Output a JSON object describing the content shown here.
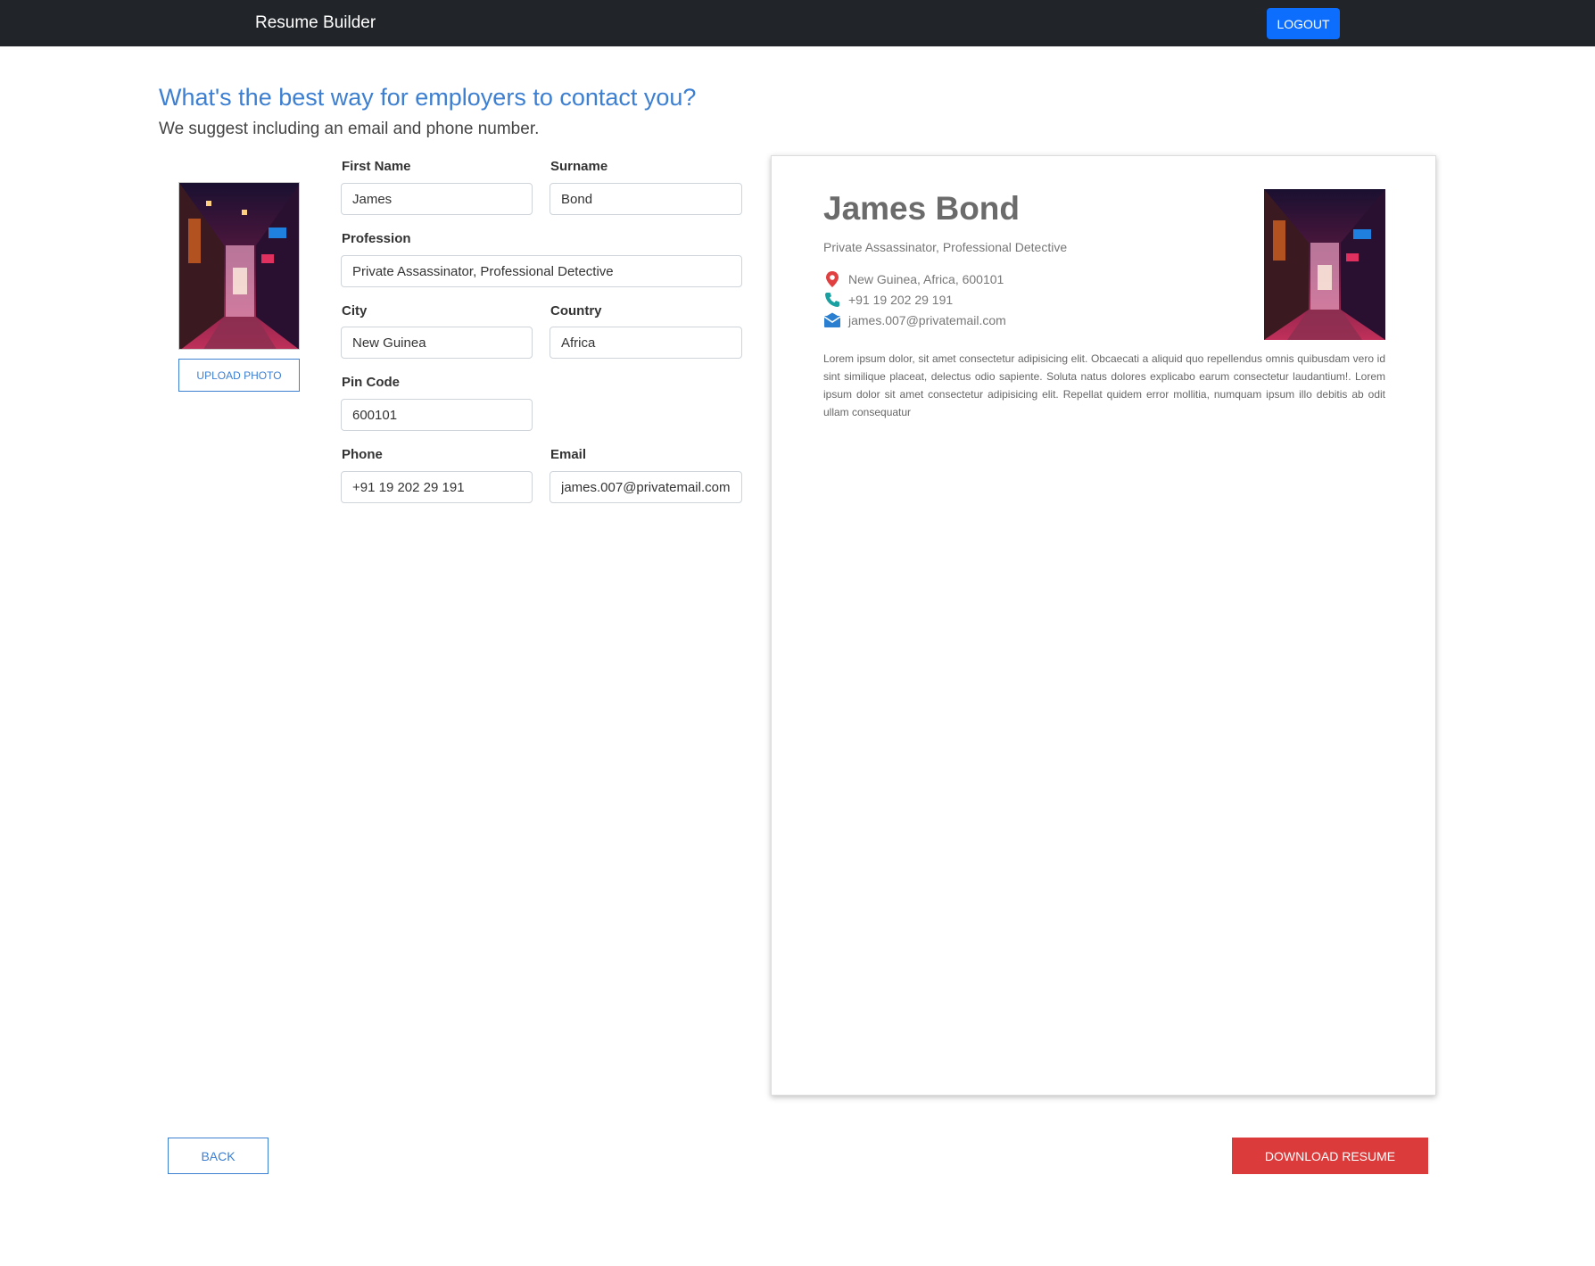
{
  "navbar": {
    "brand": "Resume Builder",
    "logout_label": "LOGOUT"
  },
  "header": {
    "title": "What's the best way for employers to contact you?",
    "subtitle": "We suggest including an email and phone number."
  },
  "photo": {
    "upload_label": "UPLOAD PHOTO"
  },
  "form": {
    "first_name": {
      "label": "First Name",
      "value": "James"
    },
    "surname": {
      "label": "Surname",
      "value": "Bond"
    },
    "profession": {
      "label": "Profession",
      "value": "Private Assassinator, Professional Detective"
    },
    "city": {
      "label": "City",
      "value": "New Guinea"
    },
    "country": {
      "label": "Country",
      "value": "Africa"
    },
    "pincode": {
      "label": "Pin Code",
      "value": "600101"
    },
    "phone": {
      "label": "Phone",
      "value": "+91 19 202 29 191"
    },
    "email": {
      "label": "Email",
      "value": "james.007@privatemail.com"
    }
  },
  "preview": {
    "name": "James Bond",
    "profession": "Private Assassinator, Professional Detective",
    "address": "New Guinea, Africa, 600101",
    "phone": "+91 19 202 29 191",
    "email": "james.007@privatemail.com",
    "summary": "Lorem ipsum dolor, sit amet consectetur adipisicing elit. Obcaecati a aliquid quo repellendus omnis quibusdam vero id sint similique placeat, delectus odio sapiente. Soluta natus dolores explicabo earum consectetur laudantium!. Lorem ipsum dolor sit amet consectetur adipisicing elit. Repellat quidem error mollitia, numquam ipsum illo debitis ab odit ullam consequatur"
  },
  "actions": {
    "back_label": "BACK",
    "download_label": "DOWNLOAD RESUME"
  },
  "colors": {
    "accent": "#3d7fd1",
    "primary": "#0d6efd",
    "danger": "#dc3b3b",
    "navbar": "#212529"
  },
  "icons": {
    "location": "location-pin-icon",
    "phone": "phone-icon",
    "email": "envelope-icon"
  }
}
